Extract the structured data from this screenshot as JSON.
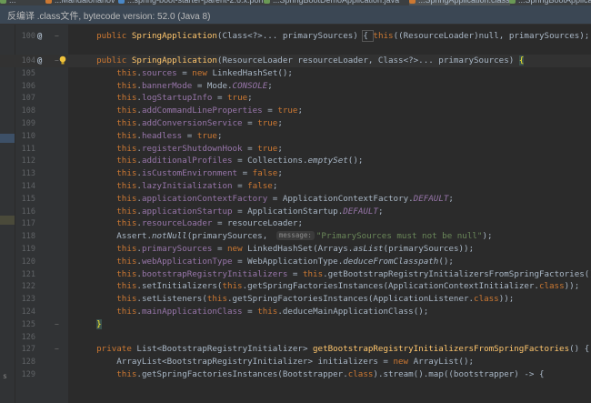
{
  "tabs": [
    {
      "label": "...",
      "color": "#6a9955"
    },
    {
      "label": "...Mandalorianov",
      "color": "#cc7832"
    },
    {
      "label": "...spring-boot-starter-parent-2.6.x.pom",
      "color": "#4a88c7"
    },
    {
      "label": "...SpringBootDemoApplication.java",
      "color": "#6a9955"
    },
    {
      "label": "...SpringApplication.class",
      "color": "#cc7832",
      "active": true
    },
    {
      "label": "...SpringBootApplicatio...",
      "color": "#6a9955"
    }
  ],
  "banner": {
    "text": "反编译 .class文件, bytecode version: 52.0 (Java 8)"
  },
  "left_strip": {
    "glyph": "s"
  },
  "editor": {
    "lines": [
      {
        "n": "100",
        "ann": "@",
        "fold": "−",
        "segs": [
          [
            "    ",
            ""
          ],
          [
            "public ",
            "k"
          ],
          [
            "SpringApplication",
            "m"
          ],
          [
            "(Class<?>... primarySources) ",
            ""
          ],
          [
            "{ ",
            "bx"
          ],
          [
            "this",
            "k"
          ],
          [
            "((ResourceLoader)",
            ""
          ],
          [
            "null",
            ""
          ],
          [
            ", primarySources); ",
            ""
          ],
          [
            "}",
            "bx"
          ]
        ]
      },
      {
        "n": "103",
        "segs": []
      },
      {
        "n": "104",
        "ann": "@",
        "fold": "−",
        "bulb": true,
        "cur": true,
        "segs": [
          [
            "    ",
            ""
          ],
          [
            "public ",
            "k"
          ],
          [
            "SpringApplication",
            "m"
          ],
          [
            "(ResourceLoader resourceLoader, Class<?>... primarySources) ",
            ""
          ],
          [
            "{",
            "brace"
          ]
        ]
      },
      {
        "n": "105",
        "segs": [
          [
            "        ",
            ""
          ],
          [
            "this",
            "k"
          ],
          [
            ".",
            ""
          ],
          [
            "sources",
            "f"
          ],
          [
            " = ",
            ""
          ],
          [
            "new ",
            "k"
          ],
          [
            "LinkedHashSet();",
            ""
          ]
        ]
      },
      {
        "n": "106",
        "segs": [
          [
            "        ",
            ""
          ],
          [
            "this",
            "k"
          ],
          [
            ".",
            ""
          ],
          [
            "bannerMode",
            "f"
          ],
          [
            " = Mode.",
            ""
          ],
          [
            "CONSOLE",
            "fi"
          ],
          [
            ";",
            ""
          ]
        ]
      },
      {
        "n": "107",
        "segs": [
          [
            "        ",
            ""
          ],
          [
            "this",
            "k"
          ],
          [
            ".",
            ""
          ],
          [
            "logStartupInfo",
            "f"
          ],
          [
            " = ",
            ""
          ],
          [
            "true",
            "k"
          ],
          [
            ";",
            ""
          ]
        ]
      },
      {
        "n": "108",
        "segs": [
          [
            "        ",
            ""
          ],
          [
            "this",
            "k"
          ],
          [
            ".",
            ""
          ],
          [
            "addCommandLineProperties",
            "f"
          ],
          [
            " = ",
            ""
          ],
          [
            "true",
            "k"
          ],
          [
            ";",
            ""
          ]
        ]
      },
      {
        "n": "109",
        "segs": [
          [
            "        ",
            ""
          ],
          [
            "this",
            "k"
          ],
          [
            ".",
            ""
          ],
          [
            "addConversionService",
            "f"
          ],
          [
            " = ",
            ""
          ],
          [
            "true",
            "k"
          ],
          [
            ";",
            ""
          ]
        ]
      },
      {
        "n": "110",
        "segs": [
          [
            "        ",
            ""
          ],
          [
            "this",
            "k"
          ],
          [
            ".",
            ""
          ],
          [
            "headless",
            "f"
          ],
          [
            " = ",
            ""
          ],
          [
            "true",
            "k"
          ],
          [
            ";",
            ""
          ]
        ]
      },
      {
        "n": "111",
        "segs": [
          [
            "        ",
            ""
          ],
          [
            "this",
            "k"
          ],
          [
            ".",
            ""
          ],
          [
            "registerShutdownHook",
            "f"
          ],
          [
            " = ",
            ""
          ],
          [
            "true",
            "k"
          ],
          [
            ";",
            ""
          ]
        ]
      },
      {
        "n": "112",
        "segs": [
          [
            "        ",
            ""
          ],
          [
            "this",
            "k"
          ],
          [
            ".",
            ""
          ],
          [
            "additionalProfiles",
            "f"
          ],
          [
            " = Collections.",
            ""
          ],
          [
            "emptySet",
            "si"
          ],
          [
            "();",
            ""
          ]
        ]
      },
      {
        "n": "113",
        "segs": [
          [
            "        ",
            ""
          ],
          [
            "this",
            "k"
          ],
          [
            ".",
            ""
          ],
          [
            "isCustomEnvironment",
            "f"
          ],
          [
            " = ",
            ""
          ],
          [
            "false",
            "k"
          ],
          [
            ";",
            ""
          ]
        ]
      },
      {
        "n": "114",
        "segs": [
          [
            "        ",
            ""
          ],
          [
            "this",
            "k"
          ],
          [
            ".",
            ""
          ],
          [
            "lazyInitialization",
            "f"
          ],
          [
            " = ",
            ""
          ],
          [
            "false",
            "k"
          ],
          [
            ";",
            ""
          ]
        ]
      },
      {
        "n": "115",
        "segs": [
          [
            "        ",
            ""
          ],
          [
            "this",
            "k"
          ],
          [
            ".",
            ""
          ],
          [
            "applicationContextFactory",
            "f"
          ],
          [
            " = ApplicationContextFactory.",
            ""
          ],
          [
            "DEFAULT",
            "fi"
          ],
          [
            ";",
            ""
          ]
        ]
      },
      {
        "n": "116",
        "segs": [
          [
            "        ",
            ""
          ],
          [
            "this",
            "k"
          ],
          [
            ".",
            ""
          ],
          [
            "applicationStartup",
            "f"
          ],
          [
            " = ApplicationStartup.",
            ""
          ],
          [
            "DEFAULT",
            "fi"
          ],
          [
            ";",
            ""
          ]
        ]
      },
      {
        "n": "117",
        "segs": [
          [
            "        ",
            ""
          ],
          [
            "this",
            "k"
          ],
          [
            ".",
            ""
          ],
          [
            "resourceLoader",
            "f"
          ],
          [
            " = resourceLoader;",
            ""
          ]
        ]
      },
      {
        "n": "118",
        "segs": [
          [
            "        Assert.",
            ""
          ],
          [
            "notNull",
            "si"
          ],
          [
            "(primarySources, ",
            ""
          ],
          [
            "message:",
            "hint"
          ],
          [
            "\"PrimarySources must not be null\"",
            "s"
          ],
          [
            ");",
            ""
          ]
        ]
      },
      {
        "n": "119",
        "segs": [
          [
            "        ",
            ""
          ],
          [
            "this",
            "k"
          ],
          [
            ".",
            ""
          ],
          [
            "primarySources",
            "f"
          ],
          [
            " = ",
            ""
          ],
          [
            "new ",
            "k"
          ],
          [
            "LinkedHashSet(Arrays.",
            ""
          ],
          [
            "asList",
            "si"
          ],
          [
            "(primarySources));",
            ""
          ]
        ]
      },
      {
        "n": "120",
        "segs": [
          [
            "        ",
            ""
          ],
          [
            "this",
            "k"
          ],
          [
            ".",
            ""
          ],
          [
            "webApplicationType",
            "f"
          ],
          [
            " = WebApplicationType.",
            ""
          ],
          [
            "deduceFromClasspath",
            "si"
          ],
          [
            "();",
            ""
          ]
        ]
      },
      {
        "n": "121",
        "segs": [
          [
            "        ",
            ""
          ],
          [
            "this",
            "k"
          ],
          [
            ".",
            ""
          ],
          [
            "bootstrapRegistryInitializers",
            "f"
          ],
          [
            " = ",
            ""
          ],
          [
            "this",
            "k"
          ],
          [
            ".getBootstrapRegistryInitializersFromSpringFactories();",
            ""
          ]
        ]
      },
      {
        "n": "122",
        "segs": [
          [
            "        ",
            ""
          ],
          [
            "this",
            "k"
          ],
          [
            ".setInitializers(",
            ""
          ],
          [
            "this",
            "k"
          ],
          [
            ".getSpringFactoriesInstances(ApplicationContextInitializer.",
            ""
          ],
          [
            "class",
            "k"
          ],
          [
            "));",
            ""
          ]
        ]
      },
      {
        "n": "123",
        "segs": [
          [
            "        ",
            ""
          ],
          [
            "this",
            "k"
          ],
          [
            ".setListeners(",
            ""
          ],
          [
            "this",
            "k"
          ],
          [
            ".getSpringFactoriesInstances(ApplicationListener.",
            ""
          ],
          [
            "class",
            "k"
          ],
          [
            "));",
            ""
          ]
        ]
      },
      {
        "n": "124",
        "segs": [
          [
            "        ",
            ""
          ],
          [
            "this",
            "k"
          ],
          [
            ".",
            ""
          ],
          [
            "mainApplicationClass",
            "f"
          ],
          [
            " = ",
            ""
          ],
          [
            "this",
            "k"
          ],
          [
            ".deduceMainApplicationClass();",
            ""
          ]
        ]
      },
      {
        "n": "125",
        "fold": "−",
        "segs": [
          [
            "    ",
            ""
          ],
          [
            "}",
            "brace"
          ]
        ]
      },
      {
        "n": "126",
        "segs": []
      },
      {
        "n": "127",
        "fold": "−",
        "segs": [
          [
            "    ",
            ""
          ],
          [
            "private ",
            "k"
          ],
          [
            "List<BootstrapRegistryInitializer> ",
            ""
          ],
          [
            "getBootstrapRegistryInitializersFromSpringFactories",
            "m"
          ],
          [
            "() {",
            ""
          ]
        ]
      },
      {
        "n": "128",
        "segs": [
          [
            "        ArrayList<BootstrapRegistryInitializer> initializers = ",
            ""
          ],
          [
            "new ",
            "k"
          ],
          [
            "ArrayList();",
            ""
          ]
        ]
      },
      {
        "n": "129",
        "segs": [
          [
            "        ",
            ""
          ],
          [
            "this",
            "k"
          ],
          [
            ".getSpringFactoriesInstances(Bootstrapper.",
            ""
          ],
          [
            "class",
            "k"
          ],
          [
            ").stream().map((bootstrapper) -> {",
            ""
          ]
        ]
      }
    ]
  }
}
